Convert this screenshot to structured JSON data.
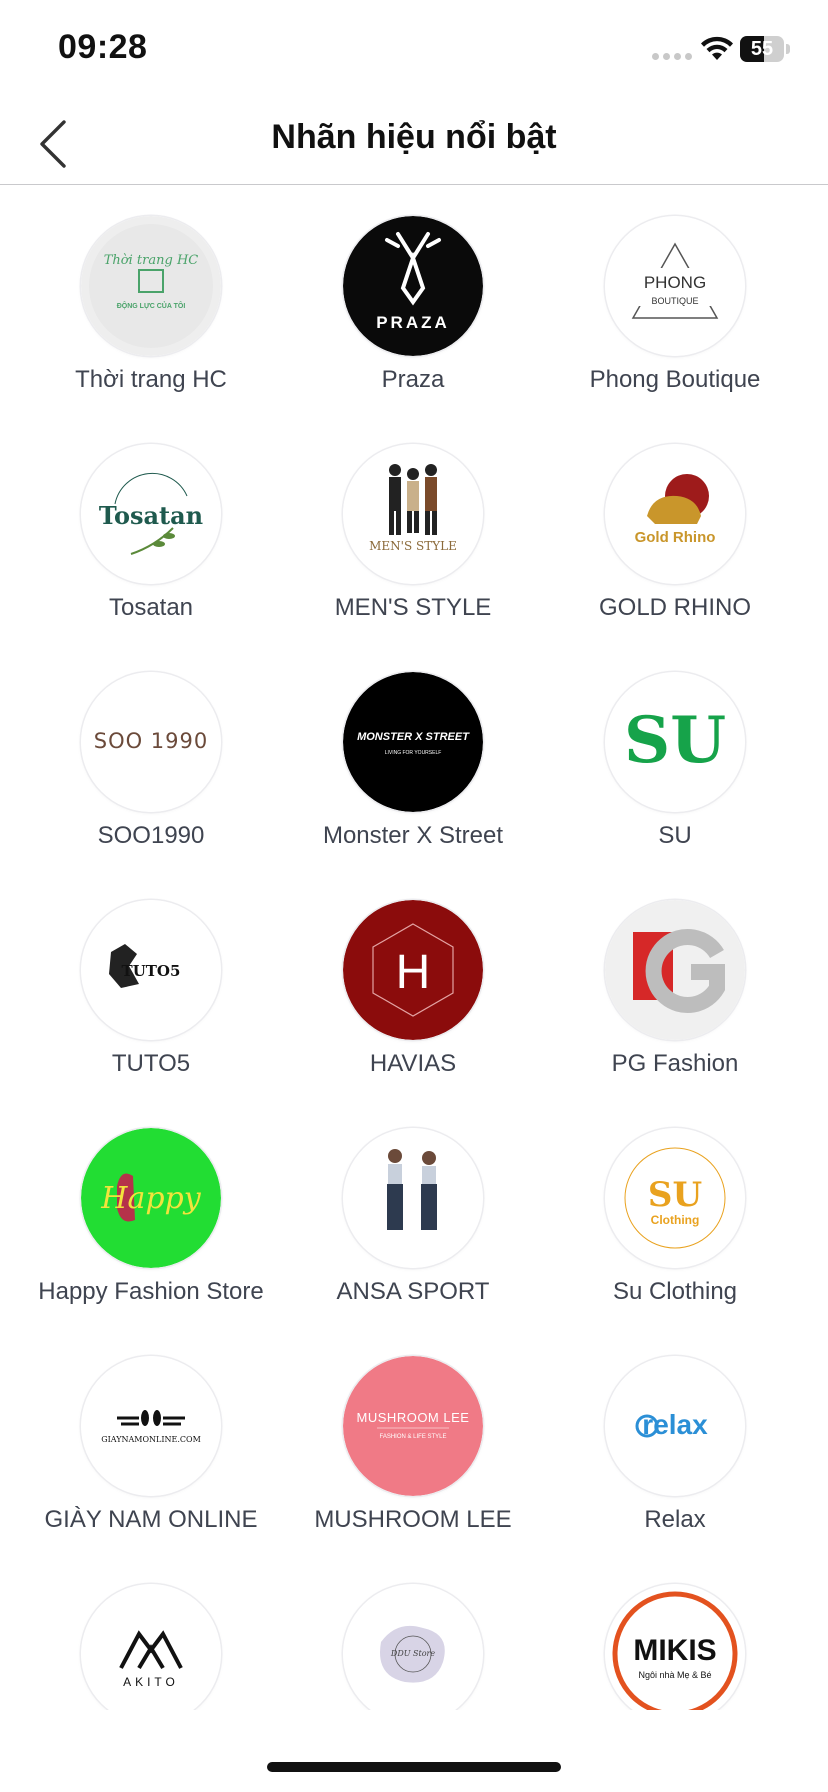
{
  "status_bar": {
    "time": "09:28",
    "battery": "55",
    "battery_level": 0.55
  },
  "header": {
    "title": "Nhãn hiệu nổi bật"
  },
  "brands": [
    {
      "name": "Thời trang HC",
      "logo_text": "Thời trang HC",
      "logo_sub": "ĐỘNG LỰC CỦA TÔI",
      "bg": "#eeeeee",
      "fg": "#4aa36a"
    },
    {
      "name": "Praza",
      "logo_text": "PRAZA",
      "logo_sub": "",
      "bg": "#0a0a0a",
      "fg": "#ffffff"
    },
    {
      "name": "Phong Boutique",
      "logo_text": "PHONG",
      "logo_sub": "BOUTIQUE",
      "bg": "#ffffff",
      "fg": "#333333"
    },
    {
      "name": "Tosatan",
      "logo_text": "Tosatan",
      "logo_sub": "",
      "bg": "#ffffff",
      "fg": "#1f5a4e"
    },
    {
      "name": "MEN'S STYLE",
      "logo_text": "MEN'S STYLE",
      "logo_sub": "",
      "bg": "#ffffff",
      "fg": "#8b6a3a"
    },
    {
      "name": "GOLD RHINO",
      "logo_text": "Gold Rhino",
      "logo_sub": "",
      "bg": "#ffffff",
      "fg": "#c9962b"
    },
    {
      "name": "SOO1990",
      "logo_text": "SOO 1990",
      "logo_sub": "",
      "bg": "#ffffff",
      "fg": "#6b4a3a"
    },
    {
      "name": "Monster X Street",
      "logo_text": "MONSTER X STREET",
      "logo_sub": "LIVING FOR YOURSELF",
      "bg": "#000000",
      "fg": "#ffffff"
    },
    {
      "name": "SU",
      "logo_text": "SU",
      "logo_sub": "",
      "bg": "#ffffff",
      "fg": "#16a34a"
    },
    {
      "name": "TUTO5",
      "logo_text": "TUTO5",
      "logo_sub": "",
      "bg": "#ffffff",
      "fg": "#111111"
    },
    {
      "name": "HAVIAS",
      "logo_text": "H",
      "logo_sub": "",
      "bg": "#8b0c0c",
      "fg": "#ffffff"
    },
    {
      "name": "PG Fashion",
      "logo_text": "PG",
      "logo_sub": "",
      "bg": "#f0f0f0",
      "fg": "#d62828"
    },
    {
      "name": "Happy Fashion Store",
      "logo_text": "Happy",
      "logo_sub": "",
      "bg": "#22dd33",
      "fg": "#f2e43c"
    },
    {
      "name": "ANSA SPORT",
      "logo_text": "",
      "logo_sub": "",
      "bg": "#ffffff",
      "fg": "#2d3a4f"
    },
    {
      "name": "Su Clothing",
      "logo_text": "SU",
      "logo_sub": "Clothing",
      "bg": "#ffffff",
      "fg": "#e9a21f"
    },
    {
      "name": "GIÀY NAM ONLINE",
      "logo_text": "GIAYNAMONLINE.COM",
      "logo_sub": "",
      "bg": "#ffffff",
      "fg": "#111111"
    },
    {
      "name": "MUSHROOM LEE",
      "logo_text": "MUSHROOM LEE",
      "logo_sub": "FASHION & LIFE STYLE",
      "bg": "#f07a86",
      "fg": "#ffffff"
    },
    {
      "name": "Relax",
      "logo_text": "relax",
      "logo_sub": "",
      "bg": "#ffffff",
      "fg": "#2b8fd6"
    },
    {
      "name": "AKITO",
      "logo_text": "AKITO",
      "logo_sub": "",
      "bg": "#ffffff",
      "fg": "#111111"
    },
    {
      "name": "DDU Store",
      "logo_text": "DDU Store",
      "logo_sub": "",
      "bg": "#ffffff",
      "fg": "#444444"
    },
    {
      "name": "MIKIS",
      "logo_text": "MIKIS",
      "logo_sub": "Ngôi nhà Mẹ & Bé",
      "bg": "#ffffff",
      "fg": "#e3521f"
    }
  ]
}
